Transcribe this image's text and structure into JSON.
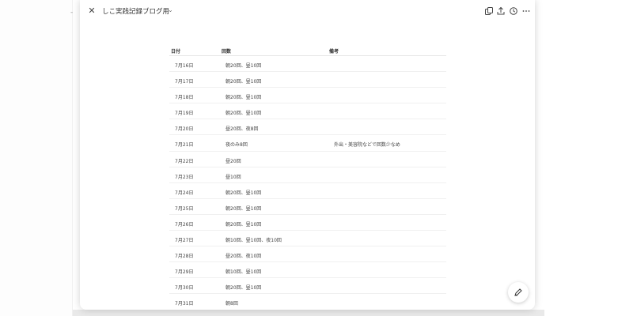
{
  "background": {
    "left_mark": "-"
  },
  "header": {
    "close_icon": "close-icon",
    "title": "しこ実践記録ブログ用",
    "chevron": "⌄",
    "icons": [
      "copy-icon",
      "share-icon",
      "history-icon",
      "more-icon"
    ]
  },
  "table": {
    "headers": {
      "date": "日付",
      "count": "回数",
      "note": "備考"
    },
    "rows": [
      {
        "date": "7月16日",
        "count": "朝20回、昼10回",
        "note": ""
      },
      {
        "date": "7月17日",
        "count": "朝20回、昼10回",
        "note": ""
      },
      {
        "date": "7月18日",
        "count": "朝20回、昼10回",
        "note": ""
      },
      {
        "date": "7月19日",
        "count": "朝20回、昼10回",
        "note": ""
      },
      {
        "date": "7月20日",
        "count": "昼20回、夜8回",
        "note": ""
      },
      {
        "date": "7月21日",
        "count": "夜のみ8回",
        "note": "外出・美容院などで回数少なめ"
      },
      {
        "date": "7月22日",
        "count": "昼20回",
        "note": ""
      },
      {
        "date": "7月23日",
        "count": "昼10回",
        "note": ""
      },
      {
        "date": "7月24日",
        "count": "朝20回、昼10回",
        "note": ""
      },
      {
        "date": "7月25日",
        "count": "朝20回、昼10回",
        "note": ""
      },
      {
        "date": "7月26日",
        "count": "朝20回、昼10回",
        "note": ""
      },
      {
        "date": "7月27日",
        "count": "朝10回、昼10回、夜10回",
        "note": ""
      },
      {
        "date": "7月28日",
        "count": "昼20回、夜10回",
        "note": ""
      },
      {
        "date": "7月29日",
        "count": "朝10回、昼10回",
        "note": ""
      },
      {
        "date": "7月30日",
        "count": "朝20回、昼10回",
        "note": ""
      },
      {
        "date": "7月31日",
        "count": "朝8回",
        "note": ""
      }
    ]
  },
  "fab": {
    "icon": "edit-pen-icon"
  },
  "colors": {
    "text": "#222222",
    "border": "#e6e6e6",
    "panel_bg": "#ffffff"
  }
}
